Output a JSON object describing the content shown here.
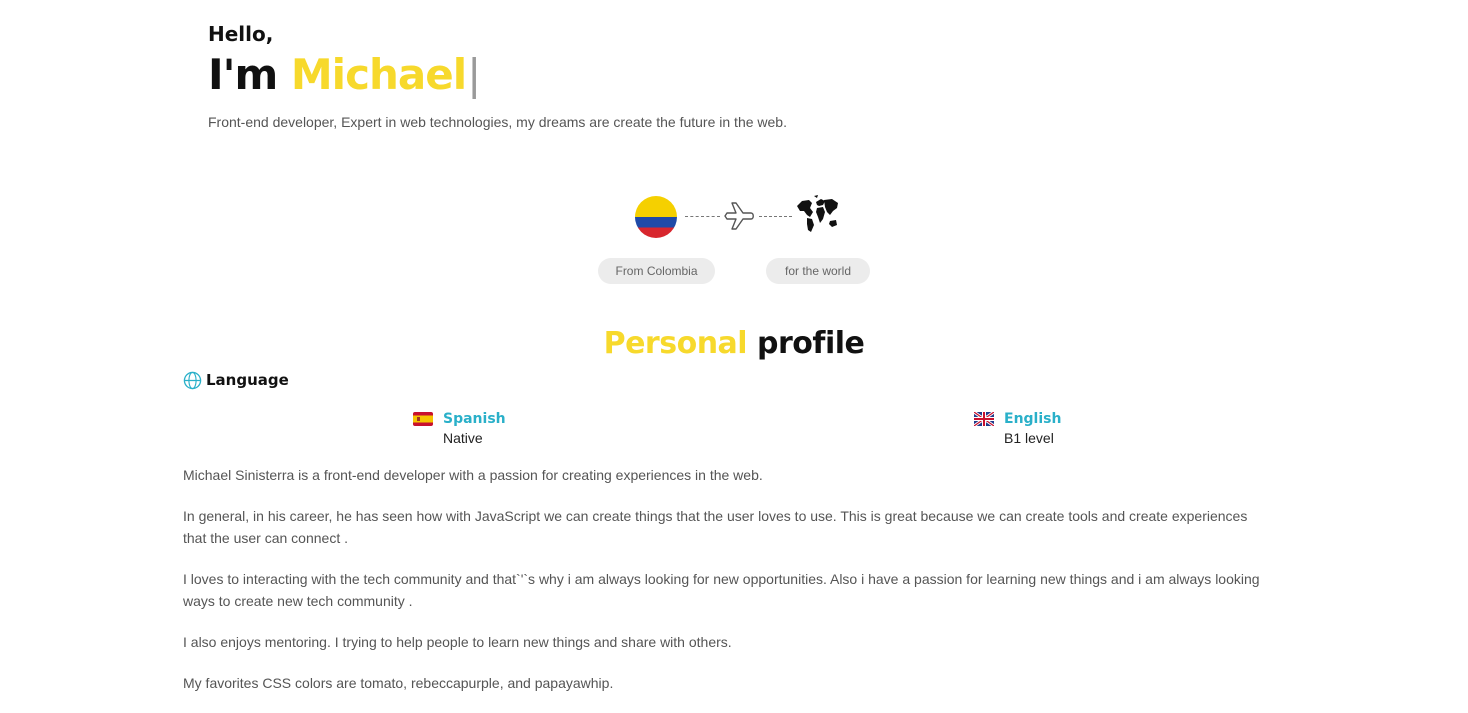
{
  "hero": {
    "greeting": "Hello,",
    "intro_prefix": "I'm",
    "name": "Michael",
    "cursor": "|",
    "tagline": "Front-end developer, Expert in web technologies, my dreams are create the future in the web."
  },
  "journey": {
    "origin_icon": "colombia-flag-icon",
    "transit_icon": "airplane-icon",
    "destination_icon": "world-map-icon",
    "origin_label": "From Colombia",
    "destination_label": "for the world"
  },
  "profile": {
    "title_highlight": "Personal",
    "title_rest": "profile",
    "language_heading": "Language",
    "language_icon": "globe-icon",
    "languages": [
      {
        "flag_icon": "spain-flag-icon",
        "name": "Spanish",
        "level": "Native"
      },
      {
        "flag_icon": "uk-flag-icon",
        "name": "English",
        "level": "B1 level"
      }
    ],
    "paragraphs": [
      "Michael Sinisterra is a front-end developer with a passion for creating experiences in the web.",
      "In general, in his career, he has seen how with JavaScript we can create things that the user loves to use. This is great because we can create tools and create experiences that the user can connect .",
      "I loves to interacting with the tech community and that`'`s why i am always looking for new opportunities. Also i have a passion for learning new things and i am always looking ways to create new tech community .",
      "I also enjoys mentoring. I trying to help people to learn new things and share with others.",
      "My favorites CSS colors are tomato, rebeccapurple, and papayawhip."
    ]
  },
  "colors": {
    "accent_yellow": "#f7d92c",
    "accent_cyan": "#2ab0c9",
    "text_dark": "#111111",
    "text_muted": "#555555",
    "pill_bg": "#ececec"
  }
}
